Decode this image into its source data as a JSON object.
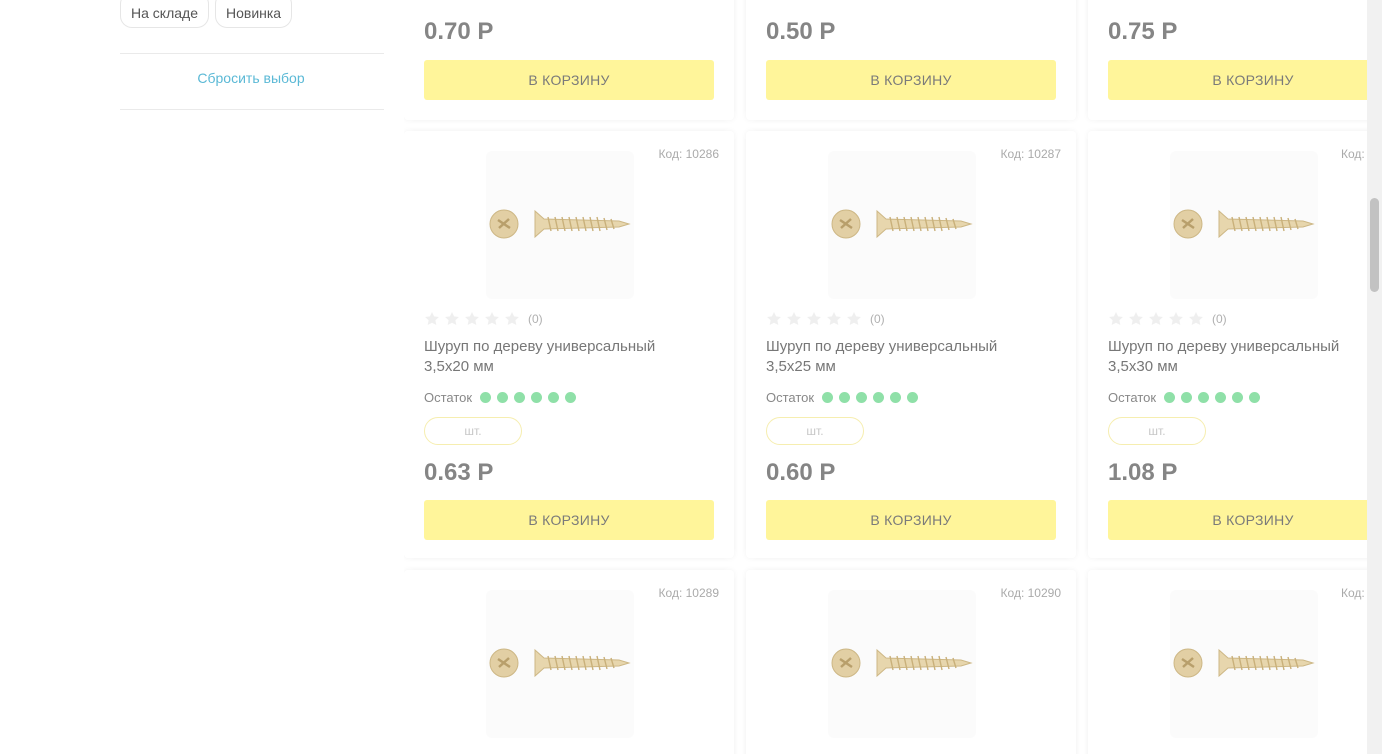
{
  "filters": {
    "chips": [
      "На складе",
      "Новинка"
    ],
    "reset_label": "Сбросить выбор"
  },
  "top_row": [
    {
      "price": "0.70 Р",
      "button": "В КОРЗИНУ"
    },
    {
      "price": "0.50 Р",
      "button": "В КОРЗИНУ"
    },
    {
      "price": "0.75 Р",
      "button": "В КОРЗИНУ"
    }
  ],
  "products": [
    {
      "code": "Код: 10286",
      "rating_count": "(0)",
      "name": "Шуруп по дереву универсальный 3,5х20 мм",
      "stock_label": "Остаток",
      "unit": "шт.",
      "price": "0.63 Р",
      "button": "В КОРЗИНУ"
    },
    {
      "code": "Код: 10287",
      "rating_count": "(0)",
      "name": "Шуруп по дереву универсальный 3,5х25 мм",
      "stock_label": "Остаток",
      "unit": "шт.",
      "price": "0.60 Р",
      "button": "В КОРЗИНУ"
    },
    {
      "code": "Код:",
      "rating_count": "(0)",
      "name": "Шуруп по дереву универсальный 3,5х30 мм",
      "stock_label": "Остаток",
      "unit": "шт.",
      "price": "1.08 Р",
      "button": "В КОРЗИНУ"
    }
  ],
  "bottom_row": [
    {
      "code": "Код: 10289"
    },
    {
      "code": "Код: 10290"
    },
    {
      "code": "Код:"
    }
  ],
  "colors": {
    "button": "#fff59a",
    "stock_dot": "#8fe0a8",
    "reset_link": "#5bb9d6"
  }
}
